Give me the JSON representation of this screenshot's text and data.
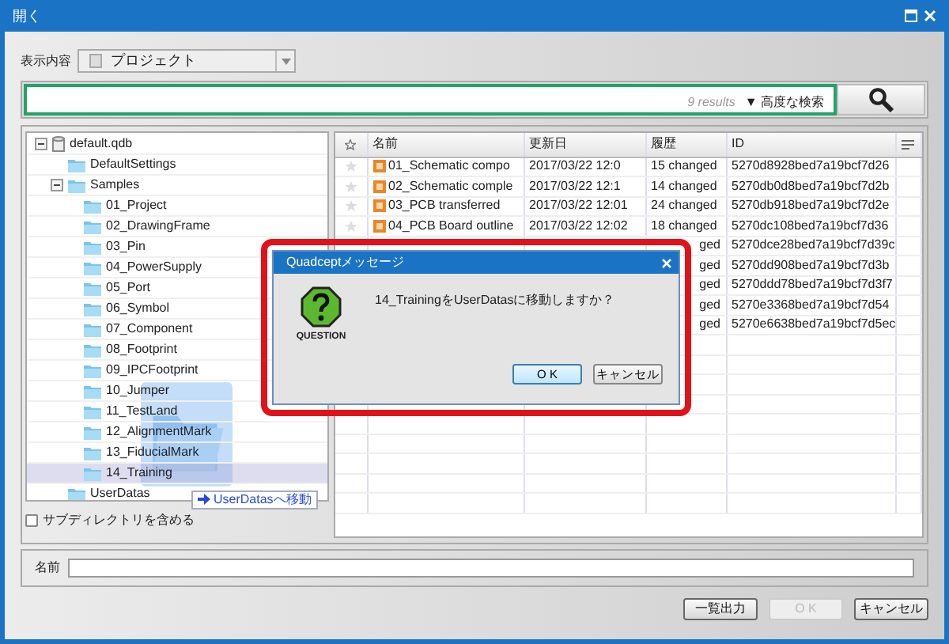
{
  "window": {
    "title": "開く"
  },
  "display": {
    "label": "表示内容",
    "value": "プロジェクト"
  },
  "search": {
    "results": "9 results",
    "advanced": "▼ 高度な検索"
  },
  "tree": {
    "items": [
      {
        "label": "default.qdb",
        "kind": "database",
        "expanded": true,
        "selected": false,
        "children": [
          {
            "label": "DefaultSettings",
            "kind": "folder",
            "selected": false
          },
          {
            "label": "Samples",
            "kind": "folder",
            "expanded": true,
            "selected": false,
            "children": [
              {
                "label": "01_Project",
                "kind": "folder",
                "selected": false
              },
              {
                "label": "02_DrawingFrame",
                "kind": "folder",
                "selected": false
              },
              {
                "label": "03_Pin",
                "kind": "folder",
                "selected": false
              },
              {
                "label": "04_PowerSupply",
                "kind": "folder",
                "selected": false
              },
              {
                "label": "05_Port",
                "kind": "folder",
                "selected": false
              },
              {
                "label": "06_Symbol",
                "kind": "folder",
                "selected": false
              },
              {
                "label": "07_Component",
                "kind": "folder",
                "selected": false
              },
              {
                "label": "08_Footprint",
                "kind": "folder",
                "selected": false
              },
              {
                "label": "09_IPCFootprint",
                "kind": "folder",
                "selected": false
              },
              {
                "label": "10_Jumper",
                "kind": "folder",
                "selected": false
              },
              {
                "label": "11_TestLand",
                "kind": "folder",
                "selected": false
              },
              {
                "label": "12_AlignmentMark",
                "kind": "folder",
                "selected": false
              },
              {
                "label": "13_FiducialMark",
                "kind": "folder",
                "selected": false
              },
              {
                "label": "14_Training",
                "kind": "folder",
                "selected": true
              }
            ]
          },
          {
            "label": "UserDatas",
            "kind": "folder",
            "selected": false
          }
        ]
      }
    ]
  },
  "include_subdirs": {
    "label": "サブディレクトリを含める",
    "checked": false
  },
  "drag": {
    "tooltip": "UserDatasへ移動"
  },
  "table": {
    "columns": [
      "名前",
      "更新日",
      "履歴",
      "ID"
    ],
    "rows": [
      {
        "name": "01_Schematic compo",
        "date": "2017/03/22 12:0",
        "history": "15 changed",
        "id": "5270d8928bed7a19bcf7d26"
      },
      {
        "name": "02_Schematic comple",
        "date": "2017/03/22 12:1",
        "history": "14 changed",
        "id": "5270db0d8bed7a19bcf7d2b"
      },
      {
        "name": "03_PCB transferred",
        "date": "2017/03/22 12:01",
        "history": "24 changed",
        "id": "5270db918bed7a19bcf7d2e"
      },
      {
        "name": "04_PCB Board outline",
        "date": "2017/03/22 12:02",
        "history": "18 changed",
        "id": "5270dc108bed7a19bcf7d36"
      },
      {
        "history": "ged",
        "id": "5270dce28bed7a19bcf7d39c"
      },
      {
        "history": "ged",
        "id": "5270dd908bed7a19bcf7d3b"
      },
      {
        "history": "ged",
        "id": "5270ddd78bed7a19bcf7d3f7"
      },
      {
        "history": "ged",
        "id": "5270e3368bed7a19bcf7d54"
      },
      {
        "history": "ged",
        "id": "5270e6638bed7a19bcf7d5ec"
      }
    ]
  },
  "name_field": {
    "label": "名前"
  },
  "buttons": [
    {
      "label": "一覧出力",
      "disabled": false
    },
    {
      "label": "O K",
      "disabled": true
    },
    {
      "label": "キャンセル",
      "disabled": false
    }
  ],
  "dialog": {
    "title": "Quadceptメッセージ",
    "icon_label": "QUESTION",
    "message": "14_TrainingをUserDatasに移動しますか？",
    "buttons": [
      {
        "label": "O K",
        "default": true
      },
      {
        "label": "キャンセル",
        "default": false
      }
    ]
  }
}
